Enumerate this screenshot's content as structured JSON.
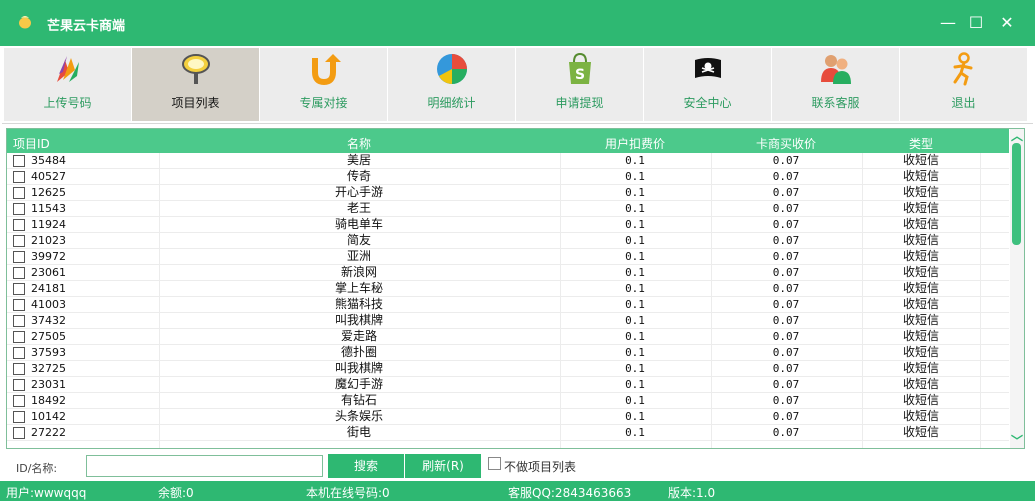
{
  "window": {
    "title": "芒果云卡商端",
    "minimize": "—",
    "maximize": "☐",
    "close": "✕"
  },
  "toolbar": [
    {
      "label": "上传号码",
      "icon": "colorful-leaves-icon",
      "active": false
    },
    {
      "label": "项目列表",
      "icon": "magnifier-icon",
      "active": true
    },
    {
      "label": "专属对接",
      "icon": "u-turn-arrow-icon",
      "active": false
    },
    {
      "label": "明细统计",
      "icon": "pie-chart-icon",
      "active": false
    },
    {
      "label": "申请提现",
      "icon": "shopping-bag-icon",
      "active": false
    },
    {
      "label": "安全中心",
      "icon": "pirate-flag-icon",
      "active": false
    },
    {
      "label": "联系客服",
      "icon": "users-icon",
      "active": false
    },
    {
      "label": "退出",
      "icon": "running-man-icon",
      "active": false
    }
  ],
  "grid": {
    "columns": {
      "id": "项目ID",
      "name": "名称",
      "user_price": "用户扣费价",
      "buy_price": "卡商买收价",
      "type": "类型"
    },
    "rows": [
      {
        "id": "35484",
        "name": "美居",
        "user_price": "0.1",
        "buy_price": "0.07",
        "type": "收短信"
      },
      {
        "id": "40527",
        "name": "传奇",
        "user_price": "0.1",
        "buy_price": "0.07",
        "type": "收短信"
      },
      {
        "id": "12625",
        "name": "开心手游",
        "user_price": "0.1",
        "buy_price": "0.07",
        "type": "收短信"
      },
      {
        "id": "11543",
        "name": "老王",
        "user_price": "0.1",
        "buy_price": "0.07",
        "type": "收短信"
      },
      {
        "id": "11924",
        "name": "骑电单车",
        "user_price": "0.1",
        "buy_price": "0.07",
        "type": "收短信"
      },
      {
        "id": "21023",
        "name": "简友",
        "user_price": "0.1",
        "buy_price": "0.07",
        "type": "收短信"
      },
      {
        "id": "39972",
        "name": "亚洲",
        "user_price": "0.1",
        "buy_price": "0.07",
        "type": "收短信"
      },
      {
        "id": "23061",
        "name": "新浪网",
        "user_price": "0.1",
        "buy_price": "0.07",
        "type": "收短信"
      },
      {
        "id": "24181",
        "name": "掌上车秘",
        "user_price": "0.1",
        "buy_price": "0.07",
        "type": "收短信"
      },
      {
        "id": "41003",
        "name": "熊猫科技",
        "user_price": "0.1",
        "buy_price": "0.07",
        "type": "收短信"
      },
      {
        "id": "37432",
        "name": "叫我棋牌",
        "user_price": "0.1",
        "buy_price": "0.07",
        "type": "收短信"
      },
      {
        "id": "27505",
        "name": "爱走路",
        "user_price": "0.1",
        "buy_price": "0.07",
        "type": "收短信"
      },
      {
        "id": "37593",
        "name": "德扑圈",
        "user_price": "0.1",
        "buy_price": "0.07",
        "type": "收短信"
      },
      {
        "id": "32725",
        "name": "叫我棋牌",
        "user_price": "0.1",
        "buy_price": "0.07",
        "type": "收短信"
      },
      {
        "id": "23031",
        "name": "魔幻手游",
        "user_price": "0.1",
        "buy_price": "0.07",
        "type": "收短信"
      },
      {
        "id": "18492",
        "name": "有钻石",
        "user_price": "0.1",
        "buy_price": "0.07",
        "type": "收短信"
      },
      {
        "id": "10142",
        "name": "头条娱乐",
        "user_price": "0.1",
        "buy_price": "0.07",
        "type": "收短信"
      },
      {
        "id": "27222",
        "name": "街电",
        "user_price": "0.1",
        "buy_price": "0.07",
        "type": "收短信"
      }
    ]
  },
  "search": {
    "label": "ID/名称:",
    "value": "",
    "search_button": "搜索",
    "refresh_button": "刷新(R)",
    "hide_checkbox_label": "不做项目列表"
  },
  "status": {
    "user": "用户:wwwqqq",
    "balance": "余额:0",
    "online": "本机在线号码:0",
    "service_qq": "客服QQ:2843463663",
    "version": "版本:1.0"
  },
  "colors": {
    "brand_green": "#2eb872",
    "header_green": "#4cc98b",
    "active_tab": "#d4d0c8"
  }
}
